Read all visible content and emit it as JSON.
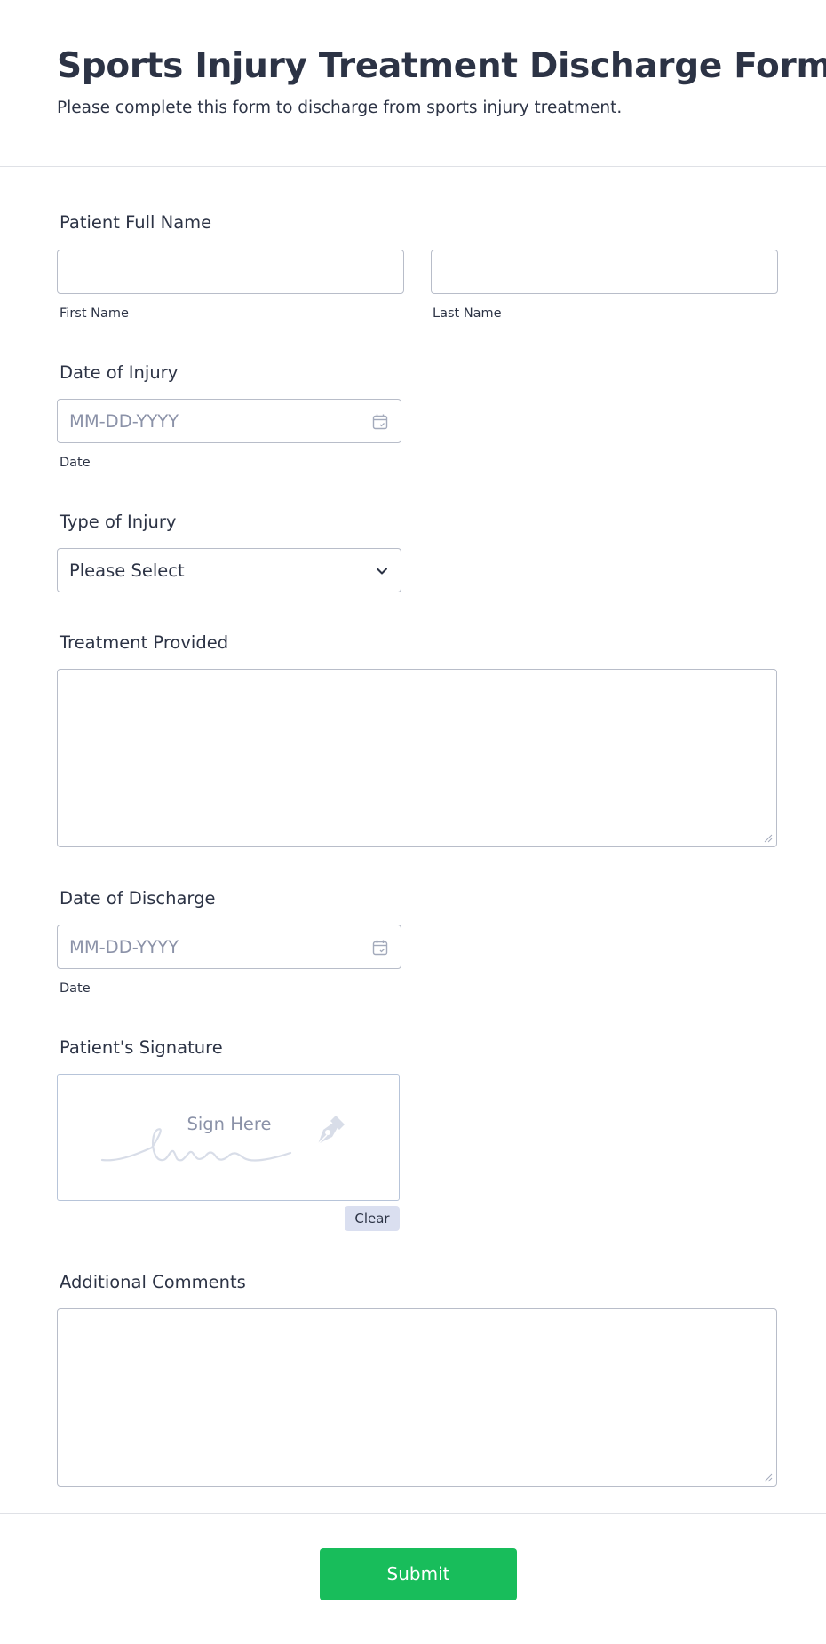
{
  "header": {
    "title": "Sports Injury Treatment Discharge Form",
    "subtitle": "Please complete this form to discharge from sports injury treatment."
  },
  "fields": {
    "patient_name": {
      "label": "Patient Full Name",
      "first_sublabel": "First Name",
      "last_sublabel": "Last Name",
      "first_value": "",
      "last_value": ""
    },
    "date_of_injury": {
      "label": "Date of Injury",
      "placeholder": "MM-DD-YYYY",
      "sublabel": "Date"
    },
    "type_of_injury": {
      "label": "Type of Injury",
      "selected": "Please Select"
    },
    "treatment_provided": {
      "label": "Treatment Provided",
      "value": ""
    },
    "date_of_discharge": {
      "label": "Date of Discharge",
      "placeholder": "MM-DD-YYYY",
      "sublabel": "Date"
    },
    "signature": {
      "label": "Patient's Signature",
      "placeholder": "Sign Here",
      "clear_label": "Clear"
    },
    "additional_comments": {
      "label": "Additional Comments",
      "value": ""
    }
  },
  "footer": {
    "submit_label": "Submit"
  },
  "colors": {
    "text": "#2c3345",
    "placeholder": "#8b92a8",
    "border": "#b8bdc9",
    "submit": "#18bd5b",
    "clear_bg": "#dadff0"
  },
  "icons": [
    "calendar-icon",
    "chevron-down-icon",
    "pen-nib-icon",
    "resize-grip-icon"
  ]
}
